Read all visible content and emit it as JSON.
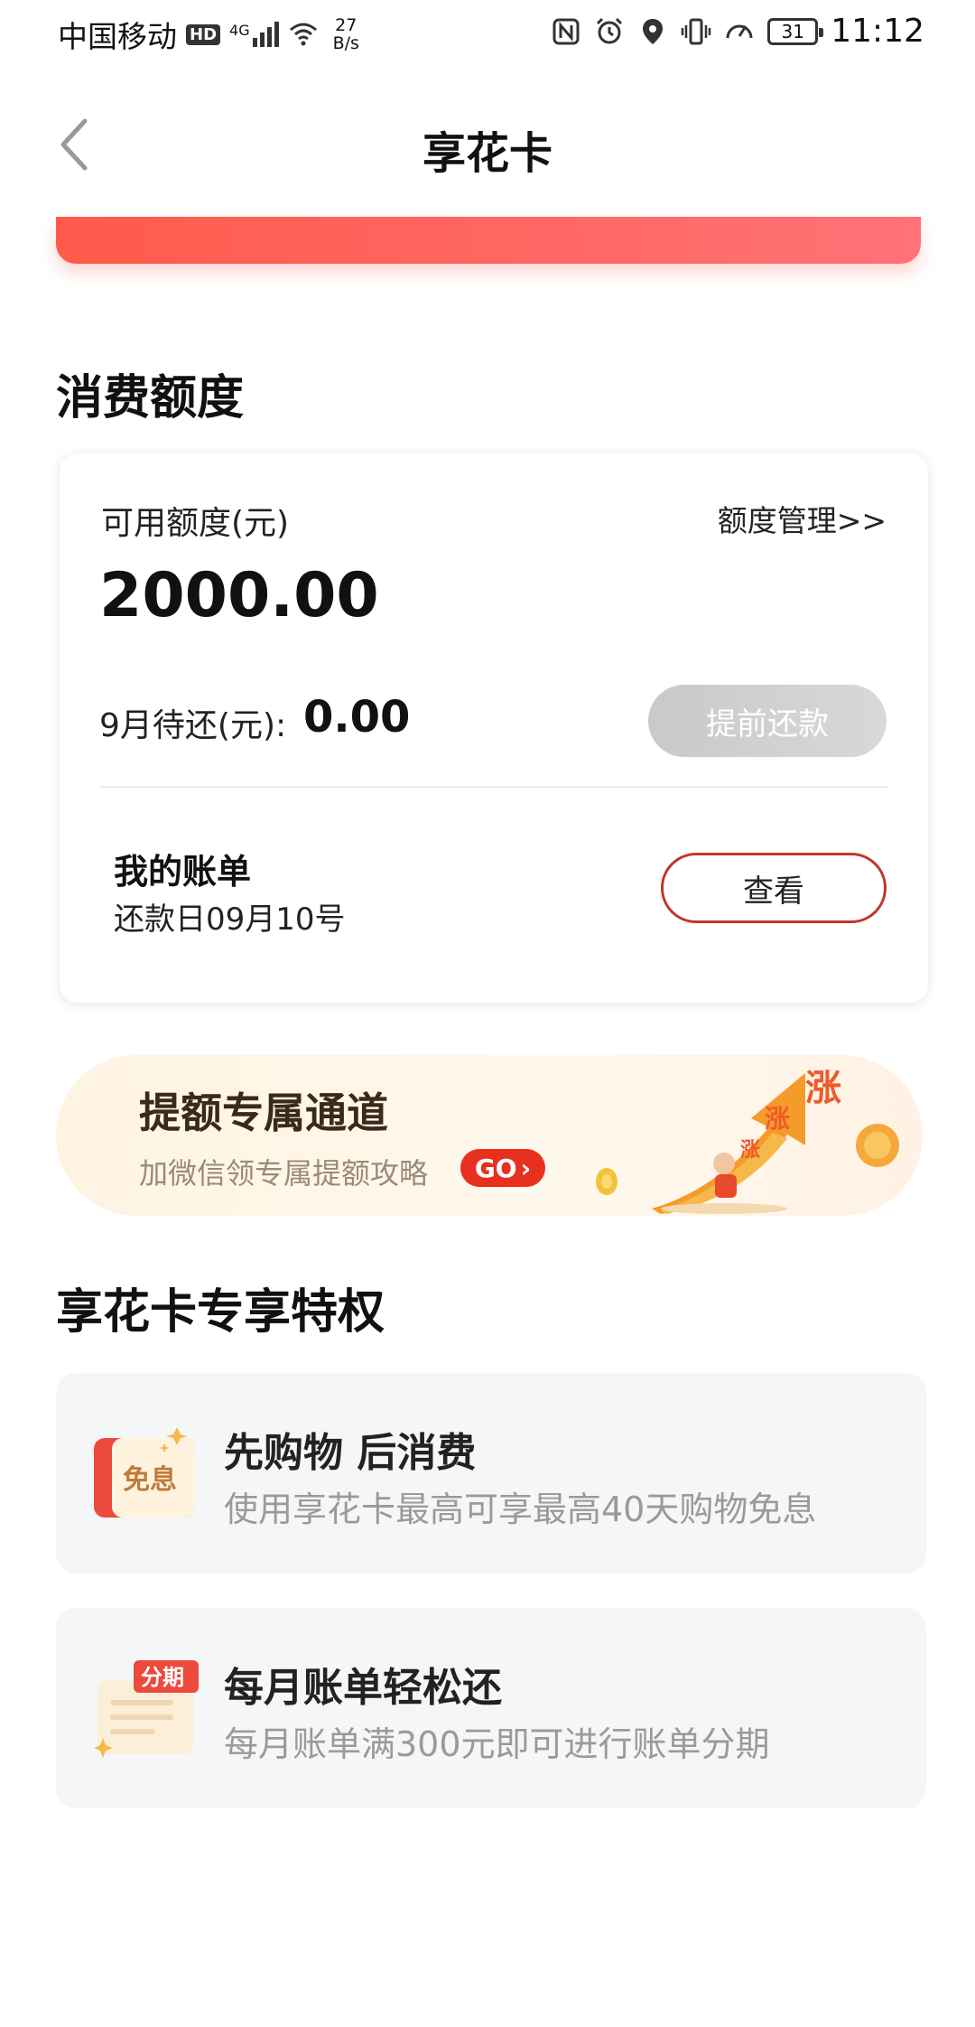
{
  "status_bar": {
    "carrier": "中国移动",
    "hd": "HD",
    "network": "4G",
    "speed_value": "27",
    "speed_unit": "B/s",
    "battery": "31",
    "time": "11:12"
  },
  "nav": {
    "title": "享花卡"
  },
  "credit": {
    "section_title": "消费额度",
    "available_label": "可用额度(元)",
    "manage_link": "额度管理>>",
    "amount": "2000.00",
    "due_label": "9月待还(元):",
    "due_value": "0.00",
    "prepay_button": "提前还款",
    "bill_title": "我的账单",
    "bill_date": "还款日09月10号",
    "view_button": "查看"
  },
  "promo": {
    "title": "提额专属通道",
    "subtitle": "加微信领专属提额攻略",
    "go_label": "GO",
    "rise_text": "涨"
  },
  "privileges": {
    "section_title": "享花卡专享特权",
    "items": [
      {
        "title": "先购物 后消费",
        "desc": "使用享花卡最高可享最高40天购物免息",
        "badge": "免息"
      },
      {
        "title": "每月账单轻松还",
        "desc": "每月账单满300元即可进行账单分期",
        "badge": "分期"
      }
    ]
  },
  "colors": {
    "accent_red": "#ff5a4a",
    "button_border": "#c0352b",
    "go_badge": "#e8301f"
  }
}
